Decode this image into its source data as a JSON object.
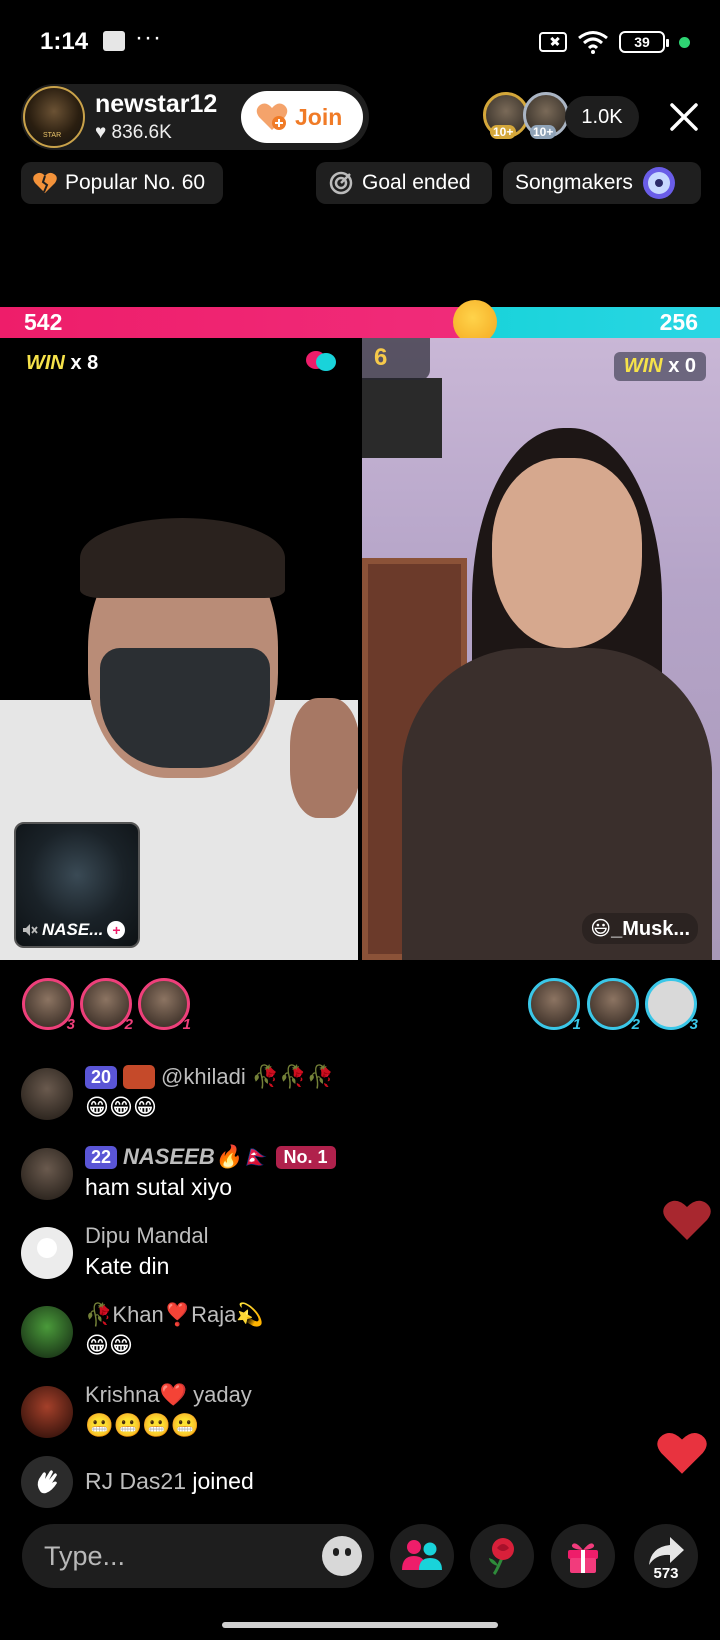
{
  "status_bar": {
    "time": "1:14",
    "dots": "···",
    "battery": "39"
  },
  "host": {
    "name": "newstar12",
    "likes": "♥ 836.6K",
    "join_label": "Join"
  },
  "viewers": {
    "badge_1": "10+",
    "badge_2": "10+",
    "count": "1.0K"
  },
  "chips": {
    "popular": "Popular No. 60",
    "goal": "Goal ended",
    "songmakers": "Songmakers"
  },
  "battle": {
    "left_score": "542",
    "right_score": "256",
    "left_share": 0.66
  },
  "left_panel": {
    "win_word": "WIN",
    "win_count": "x 8",
    "mini_cam_name": "NASE...",
    "mini_cam_plus": "+"
  },
  "right_panel": {
    "score": "6",
    "win_word": "WIN",
    "win_count": "x 0",
    "creator_name": "😃_Musk..."
  },
  "gifters_left": [
    {
      "rank": "3"
    },
    {
      "rank": "2"
    },
    {
      "rank": "1"
    }
  ],
  "gifters_right": [
    {
      "rank": "1"
    },
    {
      "rank": "2"
    },
    {
      "rank": "3"
    }
  ],
  "chat": [
    {
      "level": "20",
      "name": "@khiladi 🥀🥀🥀",
      "message": "😁😁😁"
    },
    {
      "level": "22",
      "name": "NASEEB🔥🇳🇵",
      "badge": "No. 1",
      "message": "ham sutal xiyo"
    },
    {
      "name": "Dipu Mandal",
      "message": "Kate din"
    },
    {
      "name": "🥀Khan❣️Raja💫",
      "message": "😁😁"
    },
    {
      "name": "Krishna❤️ yaday",
      "message": "😬😬😬😬"
    }
  ],
  "joined": {
    "user": "RJ Das21",
    "action": "joined"
  },
  "bottom_bar": {
    "placeholder": "Type...",
    "share_count": "573"
  },
  "colors": {
    "accent_pink": "#ee1d6a",
    "accent_cyan": "#19d3da",
    "join_orange": "#f07b27",
    "win_yellow": "#f6e24a"
  },
  "icons": [
    "sim-off-icon",
    "wifi-icon",
    "battery-icon",
    "heart-icon",
    "close-icon",
    "broken-heart-icon",
    "goal-icon",
    "music-disc-icon",
    "boxing-glove-icon",
    "mute-icon",
    "wave-icon",
    "emoji-icon",
    "guests-icon",
    "rose-icon",
    "gift-icon",
    "share-icon"
  ]
}
